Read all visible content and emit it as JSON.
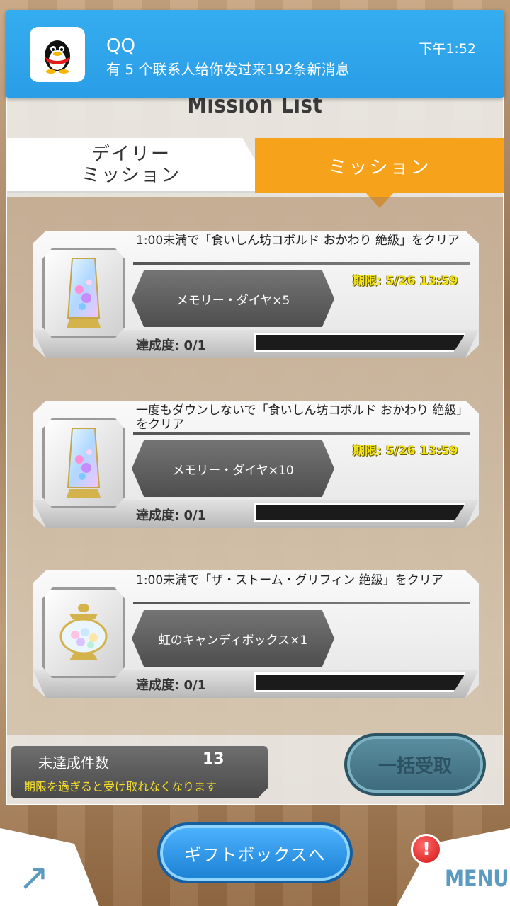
{
  "notification": {
    "app": "QQ",
    "message": "有 5 个联系人给你发过来192条新消息",
    "time": "下午1:52"
  },
  "header": {
    "title": "Mission List"
  },
  "tabs": [
    {
      "label_line1": "デイリー",
      "label_line2": "ミッション",
      "active": false
    },
    {
      "label": "ミッション",
      "active": true
    }
  ],
  "missions": [
    {
      "title": "1:00未満で「食いしん坊コボルド おかわり 絶級」をクリア",
      "reward": "メモリー・ダイヤ×5",
      "deadline": "期限: 5/26 13:59",
      "progress_label": "達成度: 0/1",
      "progress": 0,
      "icon": "memory-diamond-icon"
    },
    {
      "title": "一度もダウンしないで「食いしん坊コボルド おかわり 絶級」をクリア",
      "reward": "メモリー・ダイヤ×10",
      "deadline": "期限: 5/26 13:59",
      "progress_label": "達成度: 0/1",
      "progress": 0,
      "icon": "memory-diamond-icon"
    },
    {
      "title": "1:00未満で「ザ・ストーム・グリフィン 絶級」をクリア",
      "reward": "虹のキャンディボックス×1",
      "deadline": "",
      "progress_label": "達成度: 0/1",
      "progress": 0,
      "icon": "candy-box-icon"
    }
  ],
  "status": {
    "label": "未達成件数",
    "count": "13",
    "note": "期限を過ぎると受け取れなくなります"
  },
  "buttons": {
    "bulk_receive": "一括受取",
    "gift_box": "ギフトボックスへ",
    "menu": "MENU",
    "alert": "!"
  },
  "colors": {
    "tab_active": "#f7a21b",
    "notification": "#2fa6ec",
    "gift_button": "#1f8ae0",
    "deadline": "#f2e414"
  }
}
